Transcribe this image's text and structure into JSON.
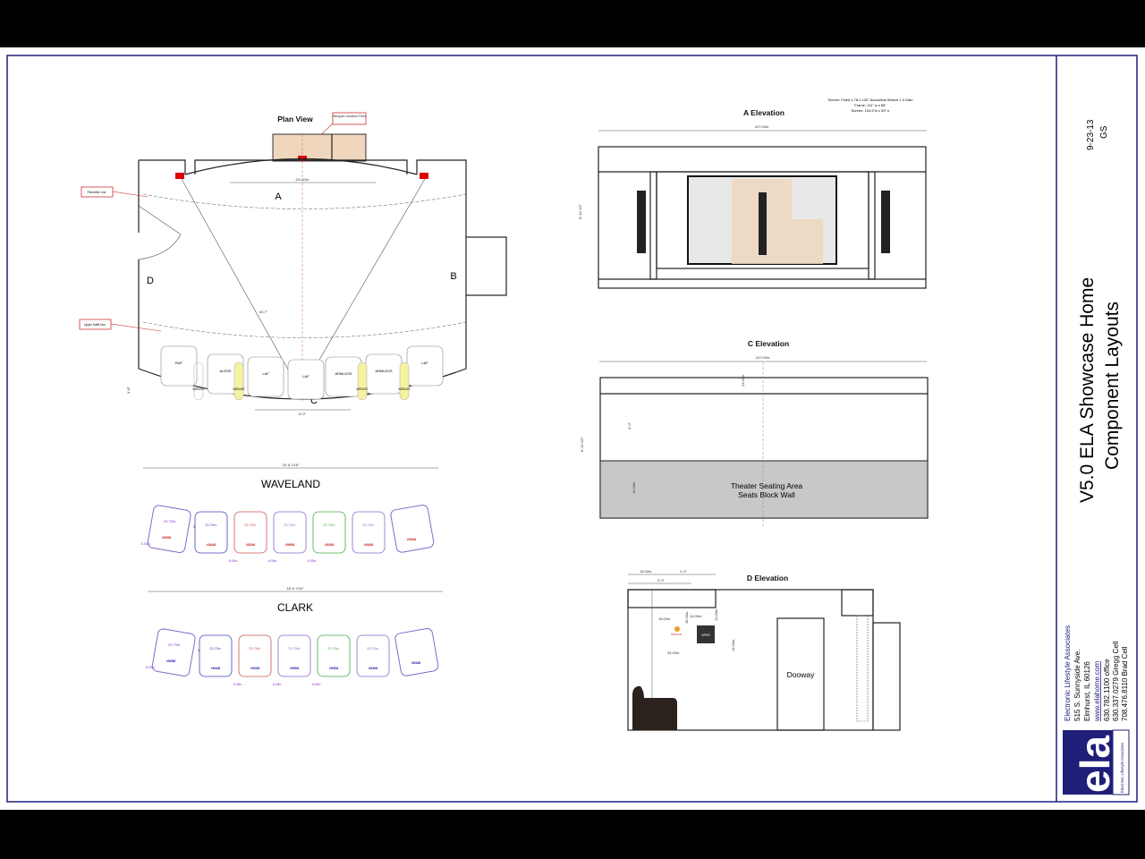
{
  "title_block": {
    "date": "9-23-13",
    "initials": "GS",
    "project_title": "V5.0 ELA Showcase Home",
    "subtitle": "Component Layouts",
    "company": "Electronic Lifestyle Associates",
    "address1": "515 S. Sunnyside Ave.",
    "address2": "Elmhurst, IL 60126",
    "website": "www.elahome.com",
    "phone_office": "630.782.1100 office",
    "phone_gregg": "630.337.0279 Gregg Cell",
    "phone_brad": "708.476.8110 Brad Cell",
    "logo_text": "ela",
    "logo_caption": "Electronic Lifestyle Associates",
    "logo_color": "#1f1f7a"
  },
  "plan_view": {
    "title": "Plan View",
    "callout_insulation": "Fiberglass Insulation Filled",
    "callout_perimeter": "Perimeter Line",
    "callout_soffit": "Upper Soffit Line",
    "wall_a": "A",
    "wall_b": "B",
    "wall_c": "C",
    "wall_d": "D",
    "dim_screen": "111.00in.",
    "dim_angle": "60.7\"",
    "dim_riser": "1'-6\"",
    "dim_row": "6'-0\"",
    "seats": [
      "RAF",
      "ALESS",
      "LAF",
      "LAF",
      "ARMLESS",
      "ARMLESS",
      "LAF"
    ],
    "wedges": [
      "WEDGE",
      "WEDGE",
      "WEDGE",
      "WEDGE"
    ],
    "wedge_color": "#f5f3a0"
  },
  "waveland": {
    "title": "WAVELAND",
    "overall": "18'-6 7/16\"",
    "corner_dim": "23.75in.",
    "gap_dim": "10 9/16\"",
    "end_dim": "6.00in.",
    "seat_dims": [
      "23.75in.",
      "23.75in.",
      "23.75in.",
      "23.75in.",
      "23.75in."
    ],
    "skus": [
      "#5058",
      "#5448",
      "#5208",
      "#5908",
      "#5308",
      "#5408",
      "#5348"
    ],
    "spacer_dims": [
      "6.00in.",
      "6.00in.",
      "6.00in."
    ]
  },
  "clark": {
    "title": "CLARK",
    "overall": "18'-6 7/16\"",
    "corner_dim": "23.75in.",
    "gap_dim": "10 9/16\"",
    "end_dim": "6.00in.",
    "seat_dims": [
      "23.75in.",
      "23.75in.",
      "23.75in.",
      "23.75in.",
      "23.75in."
    ],
    "skus": [
      "#5058",
      "#5448",
      "#5208",
      "#5908",
      "#5308",
      "#5408",
      "#5348"
    ],
    "spacer_dims": [
      "6.00in.",
      "6.00in.",
      "6.00in."
    ]
  },
  "a_elevation": {
    "title": "A Elevation",
    "screen_note1": "Screen: Fixed 1.78:1 120\" Acoustical Weave 1.3 Gain",
    "screen_note2": "Frame: 111\" w x 65\"",
    "screen_note3": "Screen: 104.5\"w x 59\" h",
    "width": "247.00in.",
    "height": "8'-10 1/2\""
  },
  "c_elevation": {
    "title": "C Elevation",
    "width": "247.00in.",
    "height": "8'-10 1/2\"",
    "dim_soffit": "13.00in.",
    "dim_mid": "4'-0\"",
    "dim_wall": "44.00in.",
    "block_label1": "Theater Seating Area",
    "block_label2": "Seats Block Wall",
    "block_color": "#c8c8c8"
  },
  "d_elevation": {
    "title": "D Elevation",
    "dim_top1": "18.00in.",
    "dim_top2": "4'-0\"",
    "dim_top3": "4'-0\"",
    "dim_sconce_x": "18.00in.",
    "dim_sconce_y": "18.00in.",
    "dim_spkr_x": "14.00in.",
    "dim_spkr_top": "12.00in.",
    "dim_spkr_h": "14.00in.",
    "dim_spkr_left": "33.00in.",
    "sconce_label": "Sconce",
    "speaker_label": "SPKR",
    "door_label": "Dooway"
  }
}
